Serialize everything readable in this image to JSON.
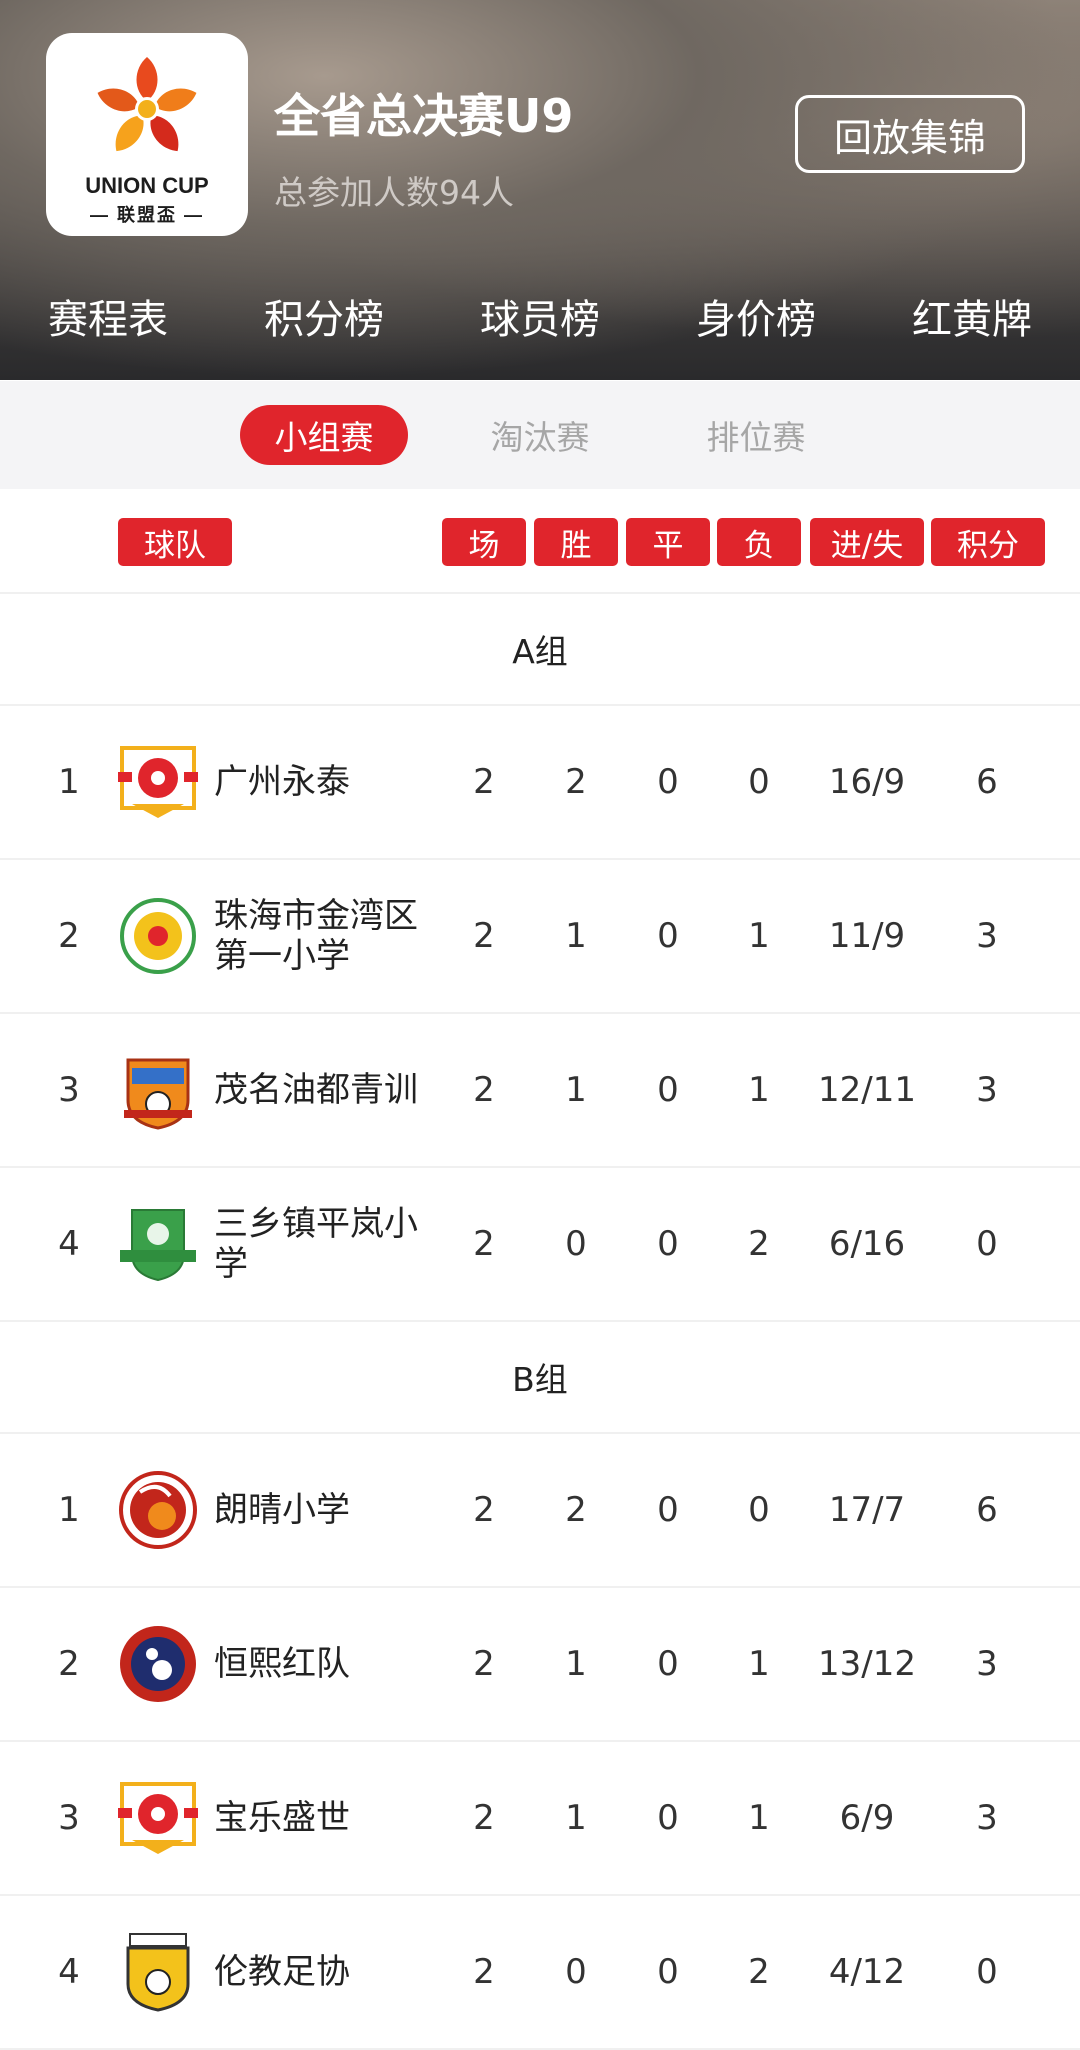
{
  "header": {
    "logo_en": "UNION CUP",
    "logo_cn": "— 联盟盃 —",
    "title": "全省总决赛U9",
    "subtitle": "总参加人数94人",
    "replay_button": "回放集锦"
  },
  "tabs": [
    {
      "label": "赛程表",
      "active": false
    },
    {
      "label": "积分榜",
      "active": true
    },
    {
      "label": "球员榜",
      "active": false
    },
    {
      "label": "身价榜",
      "active": false
    },
    {
      "label": "红黄牌",
      "active": false
    }
  ],
  "subtabs": [
    {
      "label": "小组赛",
      "active": true
    },
    {
      "label": "淘汰赛",
      "active": false
    },
    {
      "label": "排位赛",
      "active": false
    }
  ],
  "columns": {
    "team": "球队",
    "played": "场",
    "win": "胜",
    "draw": "平",
    "loss": "负",
    "goals": "进/失",
    "points": "积分"
  },
  "groups": [
    {
      "name": "A组",
      "teams": [
        {
          "rank": "1",
          "name": "广州永泰",
          "logo": "union-cup-flower-logo",
          "p": "2",
          "w": "2",
          "d": "0",
          "l": "0",
          "g": "16/9",
          "pts": "6"
        },
        {
          "rank": "2",
          "name": "珠海市金湾区第一小学",
          "logo": "green-school-badge-logo",
          "p": "2",
          "w": "1",
          "d": "0",
          "l": "1",
          "g": "11/9",
          "pts": "3"
        },
        {
          "rank": "3",
          "name": "茂名油都青训",
          "logo": "oil-city-crest-logo",
          "p": "2",
          "w": "1",
          "d": "0",
          "l": "1",
          "g": "12/11",
          "pts": "3"
        },
        {
          "rank": "4",
          "name": "三乡镇平岚小学",
          "logo": "green-shield-badge-logo",
          "p": "2",
          "w": "0",
          "d": "0",
          "l": "2",
          "g": "6/16",
          "pts": "0"
        }
      ]
    },
    {
      "name": "B组",
      "teams": [
        {
          "rank": "1",
          "name": "朗晴小学",
          "logo": "red-circle-badge-logo",
          "p": "2",
          "w": "2",
          "d": "0",
          "l": "0",
          "g": "17/7",
          "pts": "6"
        },
        {
          "rank": "2",
          "name": "恒熙红队",
          "logo": "hengxi-football-badge-logo",
          "p": "2",
          "w": "1",
          "d": "0",
          "l": "1",
          "g": "13/12",
          "pts": "3"
        },
        {
          "rank": "3",
          "name": "宝乐盛世",
          "logo": "union-cup-flower-logo",
          "p": "2",
          "w": "1",
          "d": "0",
          "l": "1",
          "g": "6/9",
          "pts": "3"
        },
        {
          "rank": "4",
          "name": "伦教足协",
          "logo": "lunjiao-fa-crest-logo",
          "p": "2",
          "w": "0",
          "d": "0",
          "l": "2",
          "g": "4/12",
          "pts": "0"
        }
      ]
    }
  ],
  "colors": {
    "accent": "#e0252c",
    "divider": "#f0f0f0",
    "subtab_bg": "#f4f4f6"
  }
}
